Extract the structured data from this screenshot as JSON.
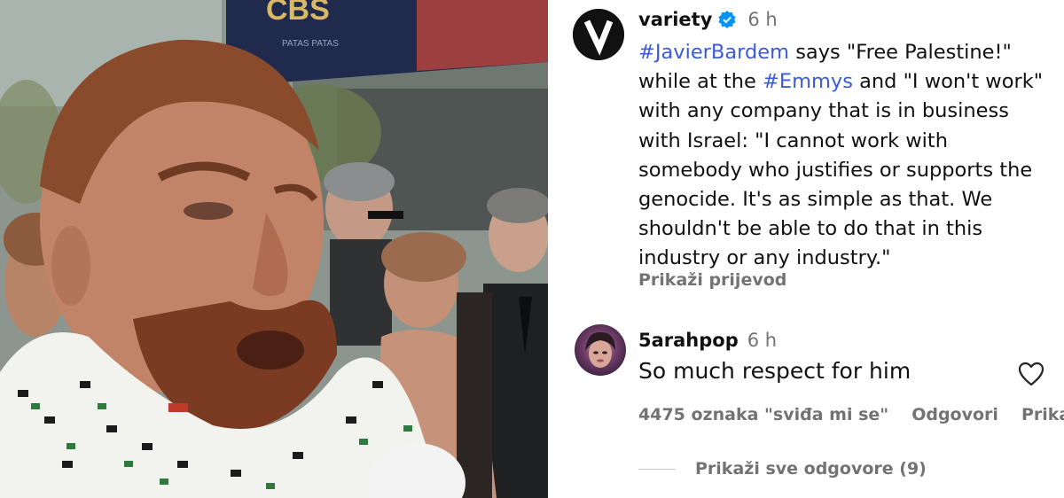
{
  "media": {
    "banner_text": "CBS",
    "banner_subtext": "PATAS PATAS"
  },
  "post": {
    "username": "variety",
    "time": "6 h",
    "caption": {
      "tag1": "#JavierBardem",
      "text1": " says \"Free Palestine!\" while at the ",
      "tag2": "#Emmys",
      "text2": " and \"I won't work\" with any company that is in business with Israel: \"I cannot work with somebody who justifies or supports the genocide. It's as simple as that. We shouldn't be able to do that in this industry or any industry.\""
    },
    "translate_label": "Prikaži prijevod"
  },
  "comment": {
    "username": "5arahpop",
    "time": "6 h",
    "text": "So much respect for him",
    "likes_label": "4475 oznaka \"sviđa mi se\"",
    "reply_label": "Odgovori",
    "translate_label": "Prikaži p",
    "view_replies_label": "Prikaži sve odgovore (9)"
  },
  "colors": {
    "hashtag": "#3b5bdb",
    "secondary_text": "#737373",
    "verified_badge": "#0095f6"
  },
  "icons": {
    "verified": "verified-badge-icon",
    "like": "heart-outline-icon"
  }
}
